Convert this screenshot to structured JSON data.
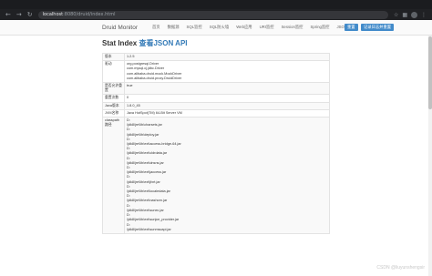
{
  "browser": {
    "url_host": "localhost",
    "url_path": ":8080/druid/index.html",
    "back_icon": "arrow-left-icon",
    "forward_icon": "arrow-right-icon",
    "reload_icon": "reload-icon"
  },
  "navbar": {
    "brand": "Druid Monitor",
    "links": [
      "首页",
      "数据源",
      "SQL监控",
      "SQL防火墙",
      "Web应用",
      "URI监控",
      "Session监控",
      "Spring监控",
      "JSON API"
    ],
    "reset_button": "重置",
    "log_reset_button": "记录日志并重置"
  },
  "page": {
    "title_prefix": "Stat Index",
    "title_link": "查看JSON API"
  },
  "table": {
    "rows": [
      {
        "key": "版本",
        "lines": [
          "1.2.5"
        ]
      },
      {
        "key": "驱动",
        "lines": [
          "org.postgresql.Driver",
          "com.mysql.cj.jdbc.Driver",
          "com.alibaba.druid.mock.MockDriver",
          "com.alibaba.druid.proxy.DruidDriver"
        ]
      },
      {
        "key": "是否允许重置",
        "lines": [
          "true"
        ]
      },
      {
        "key": "重置次数",
        "lines": [
          "0"
        ]
      },
      {
        "key": "Java版本",
        "lines": [
          "1.8.0_45"
        ]
      },
      {
        "key": "JVM名称",
        "lines": [
          "Java HotSpot(TM) 64-Bit Server VM"
        ]
      },
      {
        "key": "classpath路径",
        "lines": [
          "D:",
          "\\jdk8\\jre\\lib\\charsets.jar",
          "D:",
          "\\jdk8\\jre\\lib\\deploy.jar",
          "D:",
          "\\jdk8\\jre\\lib\\ext\\access-bridge-64.jar",
          "D:",
          "\\jdk8\\jre\\lib\\ext\\cldrdata.jar",
          "D:",
          "\\jdk8\\jre\\lib\\ext\\dnsns.jar",
          "D:",
          "\\jdk8\\jre\\lib\\ext\\jaccess.jar",
          "D:",
          "\\jdk8\\jre\\lib\\ext\\jfxrt.jar",
          "D:",
          "\\jdk8\\jre\\lib\\ext\\localedata.jar",
          "D:",
          "\\jdk8\\jre\\lib\\ext\\nashorn.jar",
          "D:",
          "\\jdk8\\jre\\lib\\ext\\sunec.jar",
          "D:",
          "\\jdk8\\jre\\lib\\ext\\sunjce_provider.jar",
          "D:",
          "\\jdk8\\jre\\lib\\ext\\sunmscapi.jar"
        ]
      }
    ]
  },
  "watermark": "CSDN @liuyunshengsir"
}
